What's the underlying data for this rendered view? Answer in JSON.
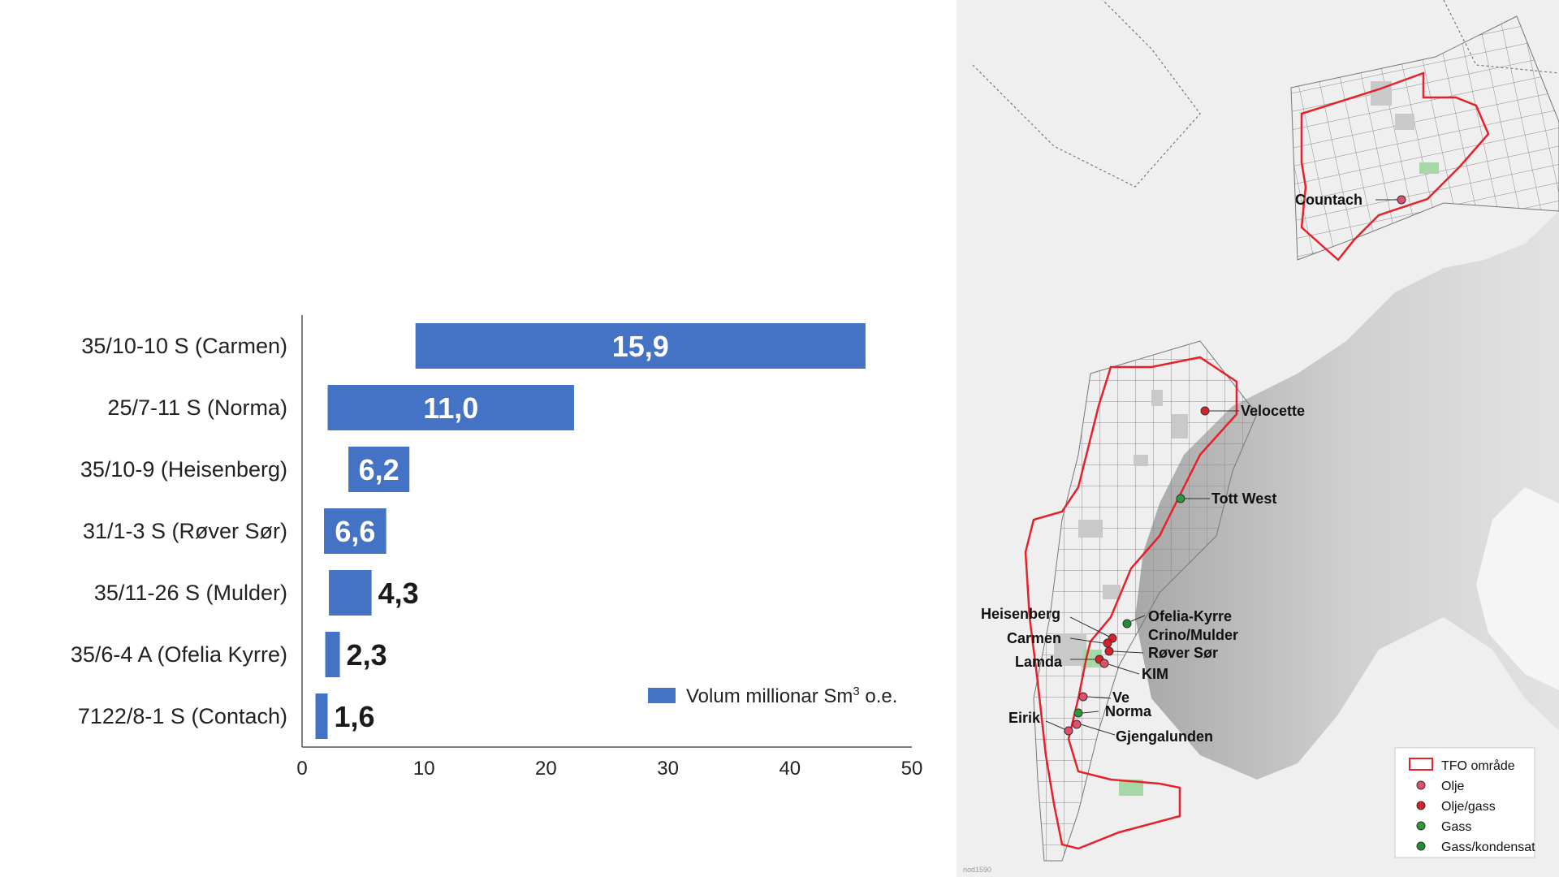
{
  "chart_data": {
    "type": "bar",
    "orientation": "horizontal",
    "categories": [
      "35/10-10 S (Carmen)",
      "25/7-11 S (Norma)",
      "35/10-9 (Heisenberg)",
      "31/1-3 S (Røver Sør)",
      "35/11-26 S (Mulder)",
      "35/6-4 A (Ofelia Kyrre)",
      "7122/8-1 S (Contach)"
    ],
    "bar_ranges": [
      [
        9.3,
        46.2
      ],
      [
        2.1,
        22.3
      ],
      [
        3.8,
        8.8
      ],
      [
        1.8,
        6.9
      ],
      [
        2.2,
        5.7
      ],
      [
        1.9,
        3.1
      ],
      [
        1.1,
        2.1
      ]
    ],
    "value_labels": [
      "15,9",
      "11,0",
      "6,2",
      "6,6",
      "4,3",
      "2,3",
      "1,6"
    ],
    "xlim": [
      0,
      50
    ],
    "xticks": [
      "0",
      "10",
      "20",
      "30",
      "40",
      "50"
    ],
    "legend": {
      "label_main": "Volum millionar Sm",
      "label_sup": "3",
      "label_tail": " o.e.",
      "position": "bottom-right"
    },
    "bar_color": "#4472c4",
    "grid": false
  },
  "map": {
    "field_labels": [
      "Countach",
      "Velocette",
      "Tott West",
      "Heisenberg",
      "Carmen",
      "Lamda",
      "Ofelia-Kyrre",
      "Crino/Mulder",
      "Røver Sør",
      "KIM",
      "Ve",
      "Norma",
      "Eirik",
      "Gjengalunden"
    ],
    "legend": [
      "TFO område",
      "Olje",
      "Olje/gass",
      "Gass",
      "Gass/kondensat"
    ],
    "credit": "nod1590",
    "colors": {
      "tfo_outline": "#e8202a",
      "oil": "#e0506a",
      "oil_gas": "#d8202a",
      "gas": "#2a9a3a",
      "gas_condensate": "#1f8f33"
    }
  }
}
